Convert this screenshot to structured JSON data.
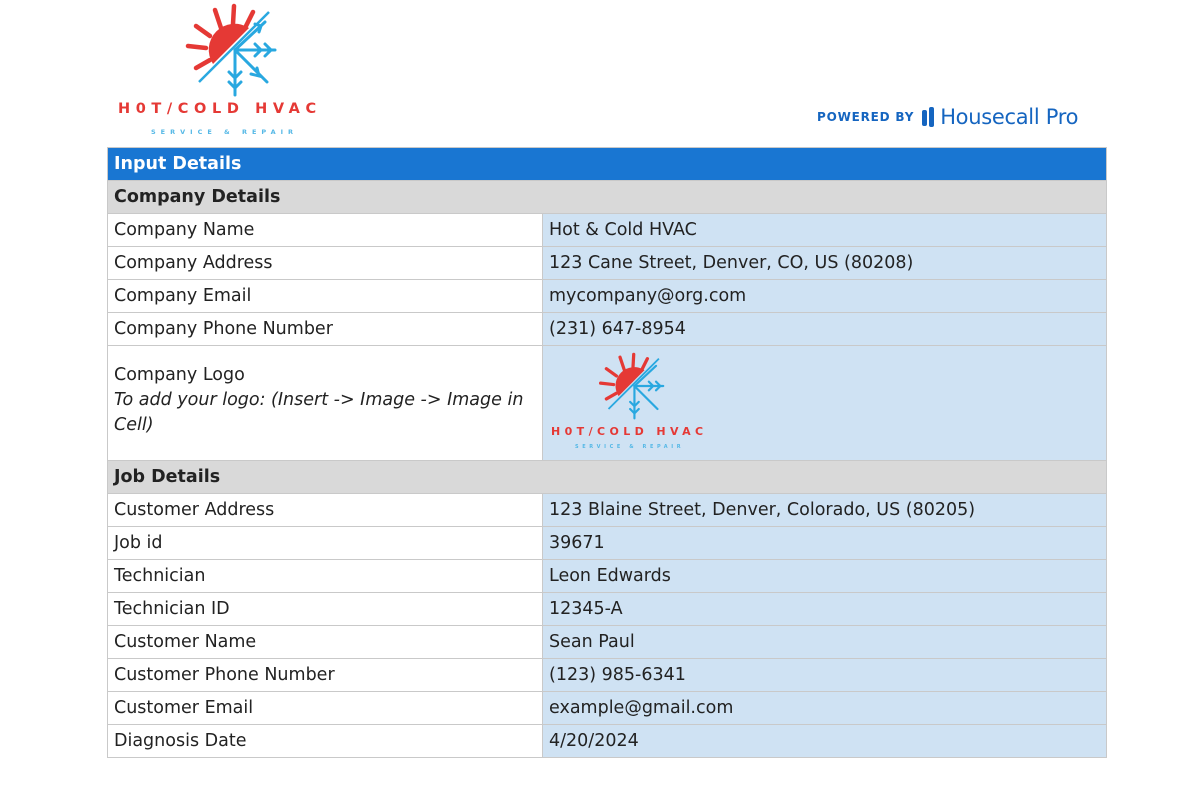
{
  "logo": {
    "name": "H0T/COLD HVAC",
    "tagline": "SERVICE & REPAIR",
    "colors": {
      "sun": "#e53935",
      "snow": "#29a8e0"
    }
  },
  "powered": {
    "prefix": "POWERED BY",
    "brand": "Housecall Pro",
    "color": "#1565c0"
  },
  "table": {
    "title": "Input Details",
    "company_section": "Company Details",
    "company_rows": [
      {
        "label": "Company Name",
        "value": "Hot & Cold HVAC"
      },
      {
        "label": "Company Address",
        "value": "123 Cane Street, Denver, CO, US (80208)"
      },
      {
        "label": "Company Email",
        "value": "mycompany@org.com"
      },
      {
        "label": "Company Phone Number",
        "value": "(231) 647-8954"
      }
    ],
    "logo_row": {
      "label": "Company Logo",
      "hint": "To add your logo: (Insert -> Image -> Image in Cell)"
    },
    "job_section": "Job Details",
    "job_rows": [
      {
        "label": "Customer Address",
        "value": "123 Blaine Street, Denver, Colorado, US (80205)"
      },
      {
        "label": "Job id",
        "value": "39671"
      },
      {
        "label": "Technician",
        "value": "Leon Edwards"
      },
      {
        "label": "Technician ID",
        "value": "12345-A"
      },
      {
        "label": "Customer Name",
        "value": "Sean Paul"
      },
      {
        "label": "Customer Phone Number",
        "value": "(123) 985-6341"
      },
      {
        "label": "Customer Email",
        "value": "example@gmail.com"
      },
      {
        "label": "Diagnosis Date",
        "value": "4/20/2024"
      }
    ],
    "colors": {
      "header": "#1976d2",
      "section": "#d9d9d9",
      "value_cell": "#cfe2f3"
    }
  }
}
